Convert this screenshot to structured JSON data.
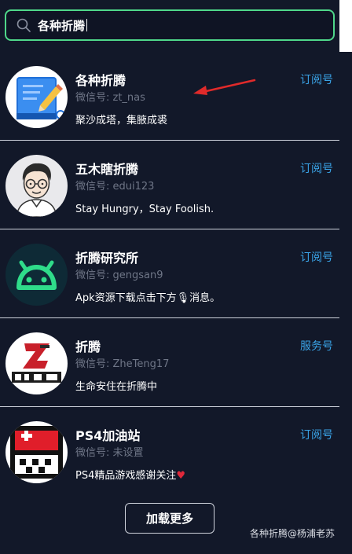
{
  "search": {
    "value": "各种折腾"
  },
  "results": [
    {
      "name": "各种折腾",
      "wechat_id": "微信号: zt_nas",
      "description": "聚沙成塔，集腋成裘",
      "type": "订阅号",
      "avatar_icon": "notebook-pencil-icon"
    },
    {
      "name": "五木瞎折腾",
      "wechat_id": "微信号: edui123",
      "description": "Stay Hungry，Stay Foolish.",
      "type": "订阅号",
      "avatar_icon": "cartoon-man-glasses-icon"
    },
    {
      "name": "折腾研究所",
      "wechat_id": "微信号: gengsan9",
      "description": "Apk资源下载点击下方🎙消息。",
      "type": "订阅号",
      "avatar_icon": "android-robot-icon"
    },
    {
      "name": "折腾",
      "wechat_id": "微信号: ZheTeng17",
      "description": "生命安住在折腾中",
      "type": "服务号",
      "avatar_icon": "zheteng-logo-icon"
    },
    {
      "name": "PS4加油站",
      "wechat_id": "微信号: 未设置",
      "description": "PS4精品游戏感谢关注",
      "description_suffix": "♥",
      "type": "订阅号",
      "avatar_icon": "pixel-pokeball-icon"
    }
  ],
  "load_more_label": "加载更多",
  "watermark": "各种折腾@杨浦老苏",
  "colors": {
    "background": "#121829",
    "accent": "#3aa4e8",
    "search_border": "#4fd88a",
    "annotation_arrow": "#e02a2a"
  }
}
